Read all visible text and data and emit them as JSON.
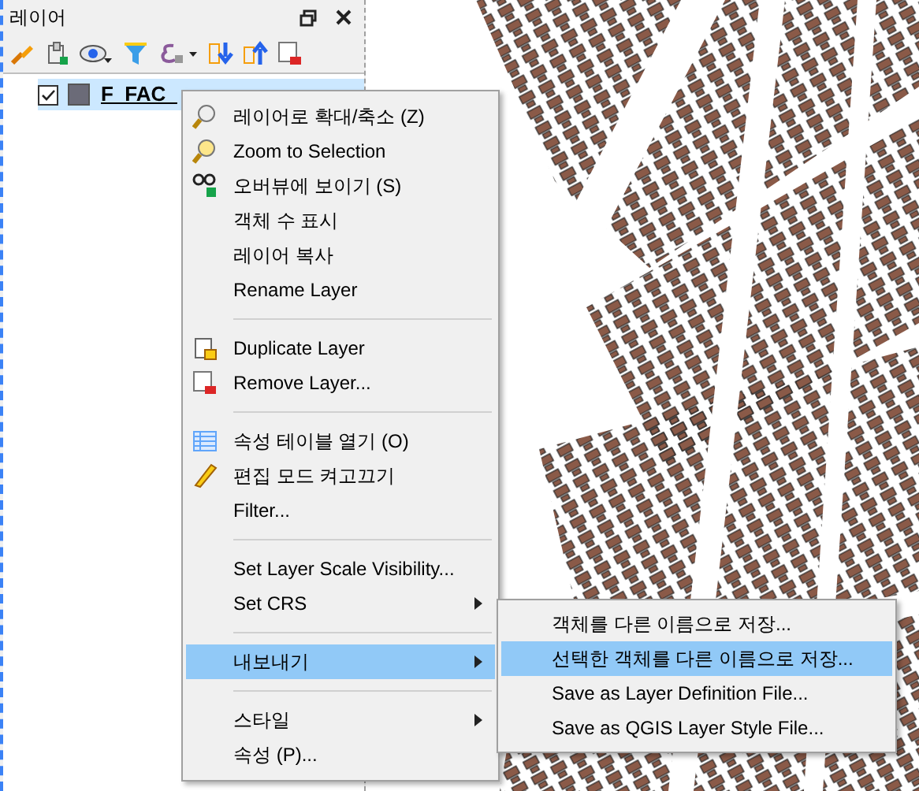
{
  "panel": {
    "title": "레이어",
    "layers": [
      {
        "name": "F_FAC_",
        "checked": true,
        "selected": true
      }
    ]
  },
  "context_menu": {
    "items": [
      {
        "kind": "item",
        "label": "레이어로 확대/축소 (Z)",
        "submenu": false,
        "selected": false
      },
      {
        "kind": "item",
        "label": "Zoom to Selection",
        "submenu": false,
        "selected": false
      },
      {
        "kind": "item",
        "label": "오버뷰에 보이기 (S)",
        "submenu": false,
        "selected": false
      },
      {
        "kind": "item",
        "label": "객체 수 표시",
        "submenu": false,
        "selected": false
      },
      {
        "kind": "item",
        "label": "레이어 복사",
        "submenu": false,
        "selected": false
      },
      {
        "kind": "item",
        "label": "Rename Layer",
        "submenu": false,
        "selected": false
      },
      {
        "kind": "separator"
      },
      {
        "kind": "item",
        "label": "Duplicate Layer",
        "submenu": false,
        "selected": false
      },
      {
        "kind": "item",
        "label": "Remove Layer...",
        "submenu": false,
        "selected": false
      },
      {
        "kind": "separator"
      },
      {
        "kind": "item",
        "label": "속성 테이블 열기 (O)",
        "submenu": false,
        "selected": false
      },
      {
        "kind": "item",
        "label": "편집 모드 켜고끄기",
        "submenu": false,
        "selected": false
      },
      {
        "kind": "item",
        "label": "Filter...",
        "submenu": false,
        "selected": false
      },
      {
        "kind": "separator"
      },
      {
        "kind": "item",
        "label": "Set Layer Scale Visibility...",
        "submenu": false,
        "selected": false
      },
      {
        "kind": "item",
        "label": "Set CRS",
        "submenu": true,
        "selected": false
      },
      {
        "kind": "separator"
      },
      {
        "kind": "item",
        "label": "내보내기",
        "submenu": true,
        "selected": true
      },
      {
        "kind": "separator"
      },
      {
        "kind": "item",
        "label": "스타일",
        "submenu": true,
        "selected": false
      },
      {
        "kind": "item",
        "label": "속성 (P)...",
        "submenu": false,
        "selected": false
      }
    ]
  },
  "submenu": {
    "items": [
      {
        "label": "객체를 다른 이름으로 저장...",
        "selected": false
      },
      {
        "label": "선택한 객체를 다른 이름으로 저장...",
        "selected": true
      },
      {
        "label": "Save as Layer Definition File...",
        "selected": false
      },
      {
        "label": "Save as QGIS Layer Style File...",
        "selected": false
      }
    ]
  }
}
